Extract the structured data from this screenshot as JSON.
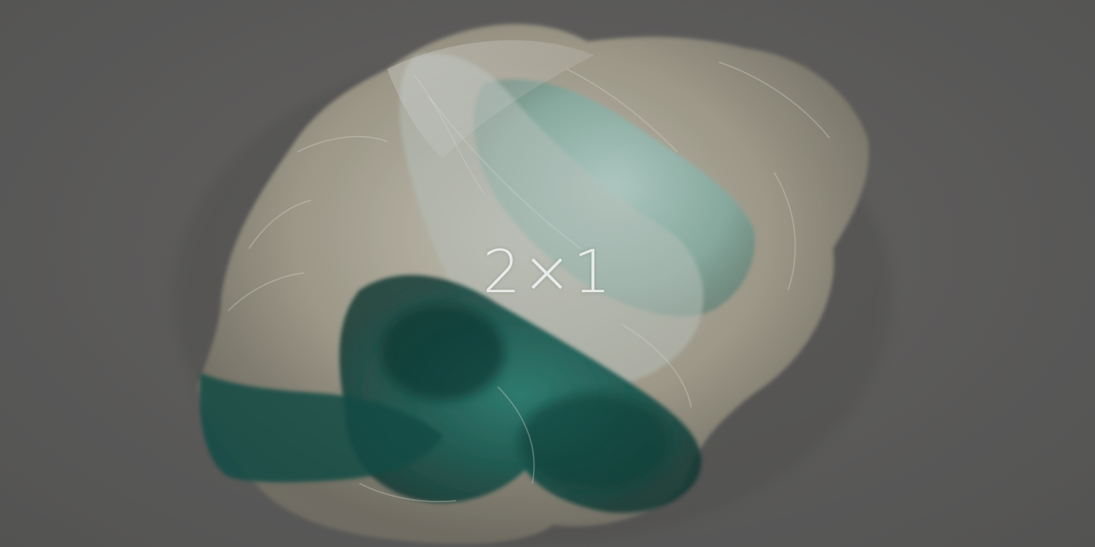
{
  "overlay_text": "2×1",
  "colors": {
    "background": "#676766",
    "caption": "#e7ebe9",
    "plastic_light": "#d8d4c6",
    "plastic_cream": "#c9c3ae",
    "plastic_teal": "#1f6b62",
    "plastic_deep_teal": "#0f4a44",
    "plastic_mint": "#9fcfc6"
  },
  "subject": "crumpled-plastic-bags"
}
